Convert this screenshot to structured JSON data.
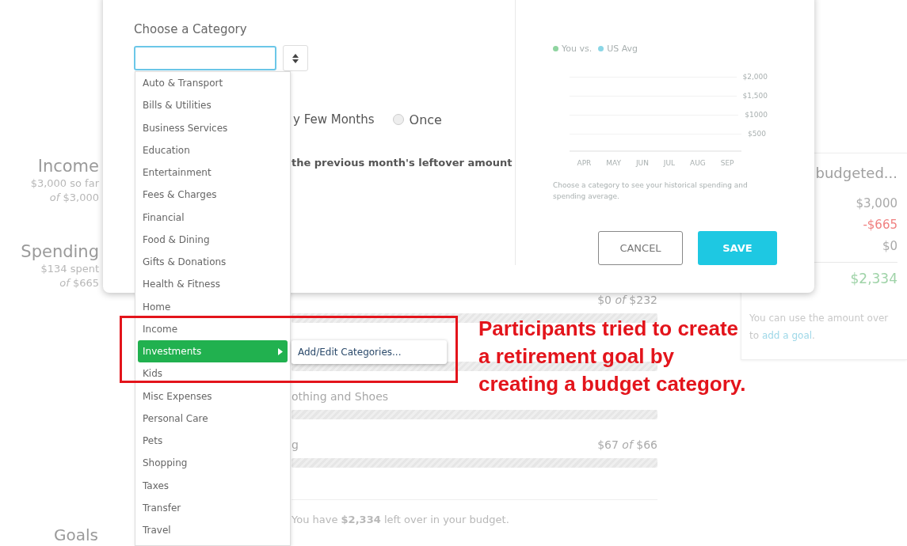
{
  "summary": [
    {
      "title": "Income",
      "amount": "$3,000 so far",
      "total": "*of* $3,000"
    },
    {
      "title": "Spending",
      "amount": "$134 spent",
      "total": "*of* $665"
    }
  ],
  "budget_rows": [
    {
      "amount": "$0 *of* $232"
    },
    {},
    {
      "name": "othing and Shoes"
    },
    {
      "name": "g",
      "amount": "$67 *of* $66"
    }
  ],
  "goals": {
    "title": "Goals",
    "note": "You have **$2,334** left over in your budget."
  },
  "budget_card": {
    "title": "budgeted...",
    "lines": [
      {
        "value": "$3,000",
        "kind": "plain"
      },
      {
        "value": "-$665",
        "kind": "negative"
      },
      {
        "value": "$0",
        "kind": "plain"
      }
    ],
    "total": "$2,334",
    "note": "You can use the amount over to",
    "link": "add a goal",
    "note_end": "."
  },
  "modal": {
    "category_label": "Choose a Category",
    "category_field": {
      "focused": true
    },
    "frequency_label": "y Few Months",
    "once_option": {
      "label": "Once",
      "selected": false
    },
    "rollover_label": "the previous month's leftover amount",
    "legend": [
      {
        "label": "You vs.",
        "color": "#8fd4a0"
      },
      {
        "label": "US Avg",
        "color": "#8ad6e6"
      }
    ],
    "y_ticks": [
      "$2,000",
      "$1,500",
      "$1000",
      "$500"
    ],
    "months": [
      "APR",
      "MAY",
      "JUN",
      "JUL",
      "AUG",
      "SEP"
    ],
    "caption": "Choose a category to see your historical spending and spending average.",
    "buttons": [
      {
        "label": "CANCEL",
        "kind": "secondary"
      },
      {
        "label": "SAVE",
        "kind": "primary"
      }
    ]
  },
  "dropdown": {
    "items": [
      {
        "label": "Auto & Transport",
        "selected": false
      },
      {
        "label": "Bills & Utilities",
        "selected": false
      },
      {
        "label": "Business Services",
        "selected": false
      },
      {
        "label": "Education",
        "selected": false
      },
      {
        "label": "Entertainment",
        "selected": false
      },
      {
        "label": "Fees & Charges",
        "selected": false
      },
      {
        "label": "Financial",
        "selected": false
      },
      {
        "label": "Food & Dining",
        "selected": false
      },
      {
        "label": "Gifts & Donations",
        "selected": false
      },
      {
        "label": "Health & Fitness",
        "selected": false
      },
      {
        "label": "Home",
        "selected": false
      },
      {
        "label": "Income",
        "selected": false
      },
      {
        "label": "Investments",
        "selected": true,
        "submenu": [
          "Add/Edit Categories..."
        ]
      },
      {
        "label": "Kids",
        "selected": false
      },
      {
        "label": "Misc Expenses",
        "selected": false
      },
      {
        "label": "Personal Care",
        "selected": false
      },
      {
        "label": "Pets",
        "selected": false
      },
      {
        "label": "Shopping",
        "selected": false
      },
      {
        "label": "Taxes",
        "selected": false
      },
      {
        "label": "Transfer",
        "selected": false
      },
      {
        "label": "Travel",
        "selected": false
      }
    ]
  },
  "annotation": {
    "lines": [
      "Participants tried to create",
      "a retirement goal by",
      "creating a budget category."
    ]
  }
}
